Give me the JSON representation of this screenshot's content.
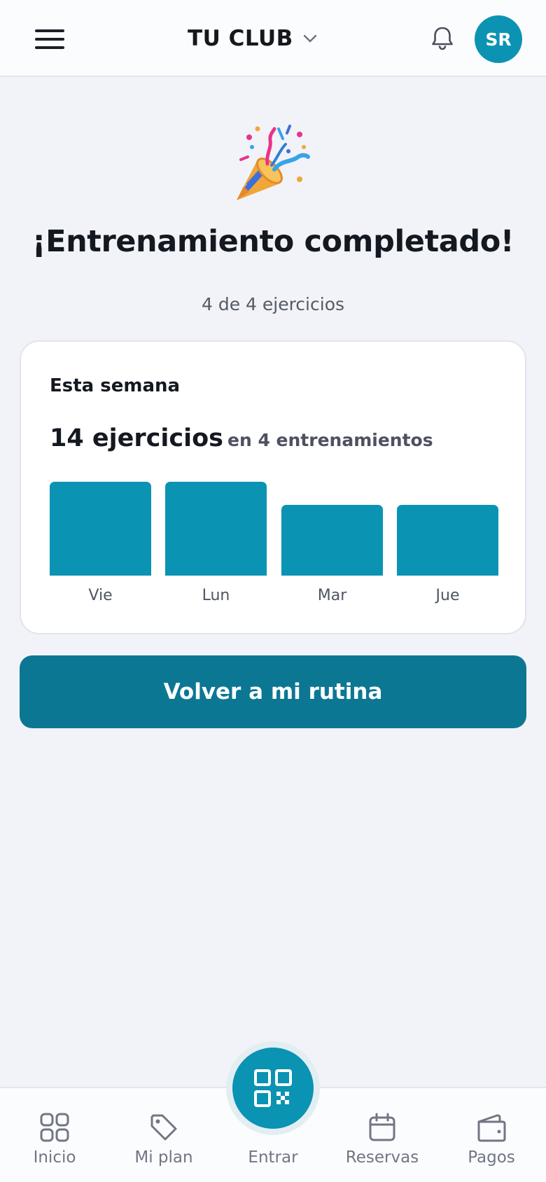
{
  "header": {
    "club_title": "TU CLUB",
    "avatar_initials": "SR"
  },
  "hero": {
    "icon": "party-popper-icon",
    "title": "¡Entrenamiento completado!",
    "subtitle": "4 de 4 ejercicios"
  },
  "weekly": {
    "label": "Esta semana",
    "exercises_text": "14 ejercicios",
    "workouts_text": "en 4 entrenamientos"
  },
  "chart_data": {
    "type": "bar",
    "categories": [
      "Vie",
      "Lun",
      "Mar",
      "Jue"
    ],
    "values": [
      4,
      4,
      3,
      3
    ],
    "ylim": [
      0,
      4
    ],
    "grid": false,
    "color": "#0b93b3"
  },
  "cta": {
    "label": "Volver a mi rutina"
  },
  "bottom_nav": {
    "items": [
      {
        "label": "Inicio",
        "icon": "grid-icon"
      },
      {
        "label": "Mi plan",
        "icon": "tag-icon"
      },
      {
        "label": "Entrar",
        "icon": "qr-code-icon"
      },
      {
        "label": "Reservas",
        "icon": "calendar-icon"
      },
      {
        "label": "Pagos",
        "icon": "wallet-icon"
      }
    ]
  },
  "colors": {
    "accent": "#0b93b3",
    "button": "#0c7793",
    "background": "#f1f3f8"
  }
}
